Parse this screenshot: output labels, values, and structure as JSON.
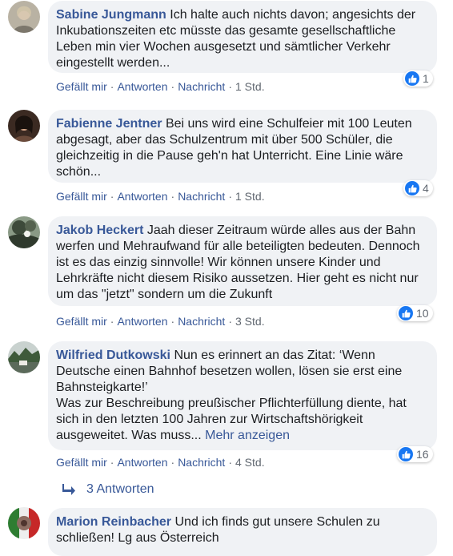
{
  "comments": [
    {
      "author": "Sabine Jungmann",
      "text": "Ich halte auch nichts davon; angesichts der\nInkubationszeiten etc müsste das gesamte gesellschaftliche\nLeben min vier Wochen ausgesetzt und sämtlicher Verkehr\neingestellt werden...",
      "more": "",
      "like": "Gefällt mir",
      "reply": "Antworten",
      "message": "Nachricht",
      "time": "1 Std.",
      "reactions": "1"
    },
    {
      "author": "Fabienne Jentner",
      "text": "Bei uns wird eine Schulfeier mit 100 Leuten\nabgesagt, aber das Schulzentrum mit über 500 Schüler, die\ngleichzeitig in die Pause geh'n hat Unterricht. Eine Linie wäre\nschön...",
      "more": "",
      "like": "Gefällt mir",
      "reply": "Antworten",
      "message": "Nachricht",
      "time": "1 Std.",
      "reactions": "4"
    },
    {
      "author": "Jakob Heckert",
      "text": "Jaah dieser Zeitraum würde alles aus der Bahn\nwerfen und Mehraufwand für alle beteiligten bedeuten. Dennoch\nist es das einzig sinnvolle! Wir können unsere Kinder und\nLehrkräfte nicht diesem Risiko aussetzen. Hier geht es nicht nur\num das \"jetzt\" sondern um die Zukunft",
      "more": "",
      "like": "Gefällt mir",
      "reply": "Antworten",
      "message": "Nachricht",
      "time": "3 Std.",
      "reactions": "10"
    },
    {
      "author": "Wilfried Dutkowski",
      "text": "Nun es erinnert an das Zitat: ‘Wenn\nDeutsche einen Bahnhof besetzen wollen, lösen sie erst eine\nBahnsteigkarte!’\nWas zur Beschreibung preußischer Pflichterfüllung diente, hat\nsich in den letzten 100 Jahren zur Wirtschaftshörigkeit\nausgeweitet. Was muss... ",
      "more": "Mehr anzeigen",
      "like": "Gefällt mir",
      "reply": "Antworten",
      "message": "Nachricht",
      "time": "4 Std.",
      "reactions": "16"
    },
    {
      "author": "Marion Reinbacher",
      "text": "Und ich finds gut unsere Schulen zu\nschließen! Lg aus Österreich",
      "more": "",
      "like": "",
      "reply": "",
      "message": "",
      "time": "",
      "reactions": ""
    }
  ],
  "replies_link": "3 Antworten",
  "colors": {
    "author": "#385898",
    "bubble": "#f0f2f5",
    "like_badge": "#1877f2",
    "meta": "#606770"
  },
  "icons": [
    "avatar",
    "like-icon",
    "reply-arrow-icon"
  ]
}
